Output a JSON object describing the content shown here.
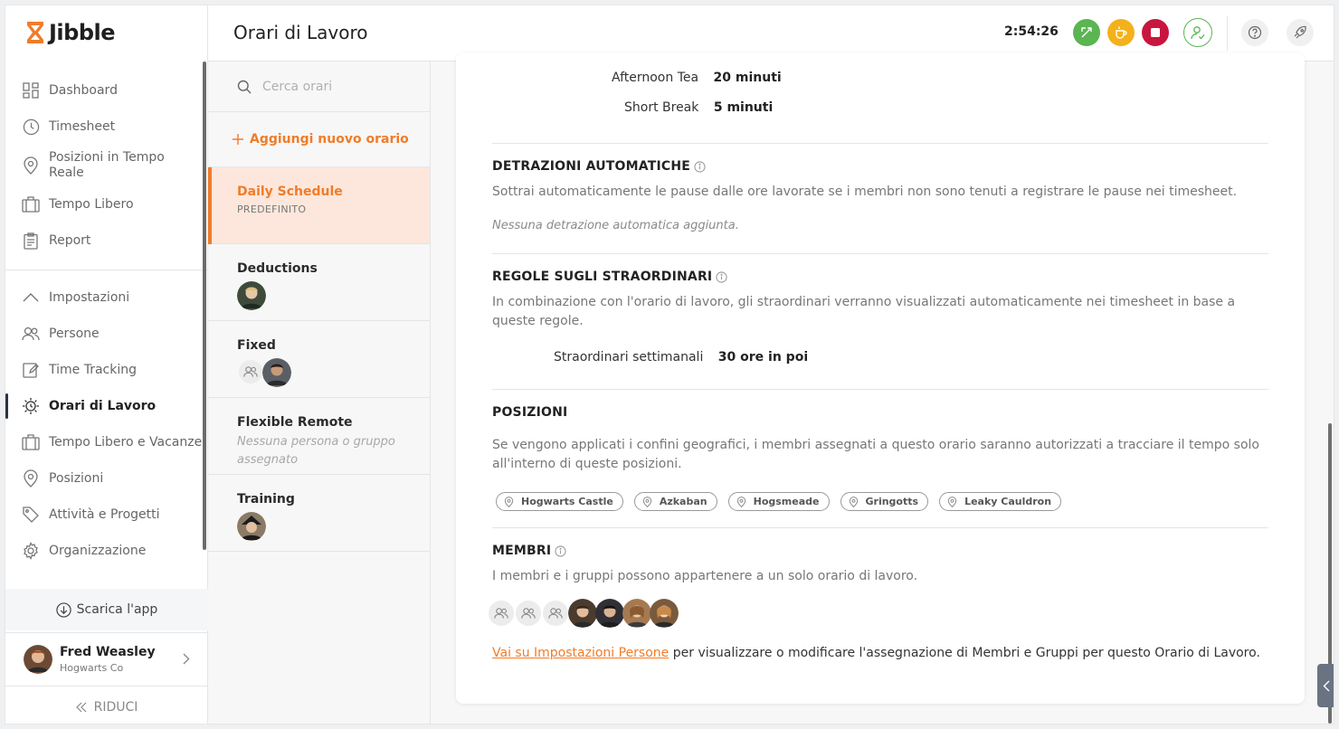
{
  "app": {
    "brand": "Jibble"
  },
  "sidebar": {
    "primary": [
      {
        "label": "Dashboard",
        "icon": "dashboard-icon"
      },
      {
        "label": "Timesheet",
        "icon": "clock-icon"
      },
      {
        "label": "Posizioni in Tempo Reale",
        "icon": "map-pin-icon"
      },
      {
        "label": "Tempo Libero",
        "icon": "suitcase-icon"
      },
      {
        "label": "Report",
        "icon": "clipboard-icon"
      }
    ],
    "settings_label": "Impostazioni",
    "settings": [
      {
        "label": "Persone",
        "icon": "people-icon"
      },
      {
        "label": "Time Tracking",
        "icon": "edit-icon"
      },
      {
        "label": "Orari di Lavoro",
        "icon": "gear-clock-icon",
        "active": true
      },
      {
        "label": "Tempo Libero e Vacanze",
        "icon": "suitcase-icon"
      },
      {
        "label": "Posizioni",
        "icon": "map-pin-icon"
      },
      {
        "label": "Attività e Progetti",
        "icon": "tag-icon"
      },
      {
        "label": "Organizzazione",
        "icon": "gear-icon"
      }
    ],
    "download_label": "Scarica l'app",
    "user": {
      "name": "Fred Weasley",
      "org": "Hogwarts Co"
    },
    "collapse_label": "RIDUCI"
  },
  "header": {
    "title": "Orari di Lavoro",
    "timer": "2:54:26",
    "colors": {
      "switch": "#5ab552",
      "break": "#f3b21b",
      "stop": "#c8163f",
      "accent": "#f07c2a"
    }
  },
  "schedules": {
    "search_placeholder": "Cerca orari",
    "add_label": "Aggiungi nuovo orario",
    "items": [
      {
        "name": "Daily Schedule",
        "sub": "PREDEFINITO",
        "active": true
      },
      {
        "name": "Deductions"
      },
      {
        "name": "Fixed"
      },
      {
        "name": "Flexible Remote",
        "empty": "Nessuna persona o gruppo assegnato"
      },
      {
        "name": "Training"
      }
    ]
  },
  "detail": {
    "breaks": [
      {
        "label": "Afternoon Tea",
        "value": "20 minuti"
      },
      {
        "label": "Short Break",
        "value": "5 minuti"
      }
    ],
    "auto_deductions": {
      "title": "DETRAZIONI AUTOMATICHE",
      "desc": "Sottrai automaticamente le pause dalle ore lavorate se i membri non sono tenuti a registrare le pause nei timesheet.",
      "empty": "Nessuna detrazione automatica aggiunta."
    },
    "overtime": {
      "title": "REGOLE SUGLI STRAORDINARI",
      "desc": "In combinazione con l'orario di lavoro, gli straordinari verranno visualizzati automaticamente nei timesheet in base a queste regole.",
      "label": "Straordinari settimanali",
      "value": "30 ore in poi"
    },
    "locations": {
      "title": "POSIZIONI",
      "desc": "Se vengono applicati i confini geografici, i membri assegnati a questo orario saranno autorizzati a tracciare il tempo solo all'interno di queste posizioni.",
      "items": [
        "Hogwarts Castle",
        "Azkaban",
        "Hogsmeade",
        "Gringotts",
        "Leaky Cauldron"
      ]
    },
    "members": {
      "title": "MEMBRI",
      "desc": "I membri e i gruppi possono appartenere a un solo orario di lavoro.",
      "link": "Vai su Impostazioni Persone",
      "note": " per visualizzare o modificare l'assegnazione di Membri e Gruppi per questo Orario di Lavoro."
    }
  }
}
